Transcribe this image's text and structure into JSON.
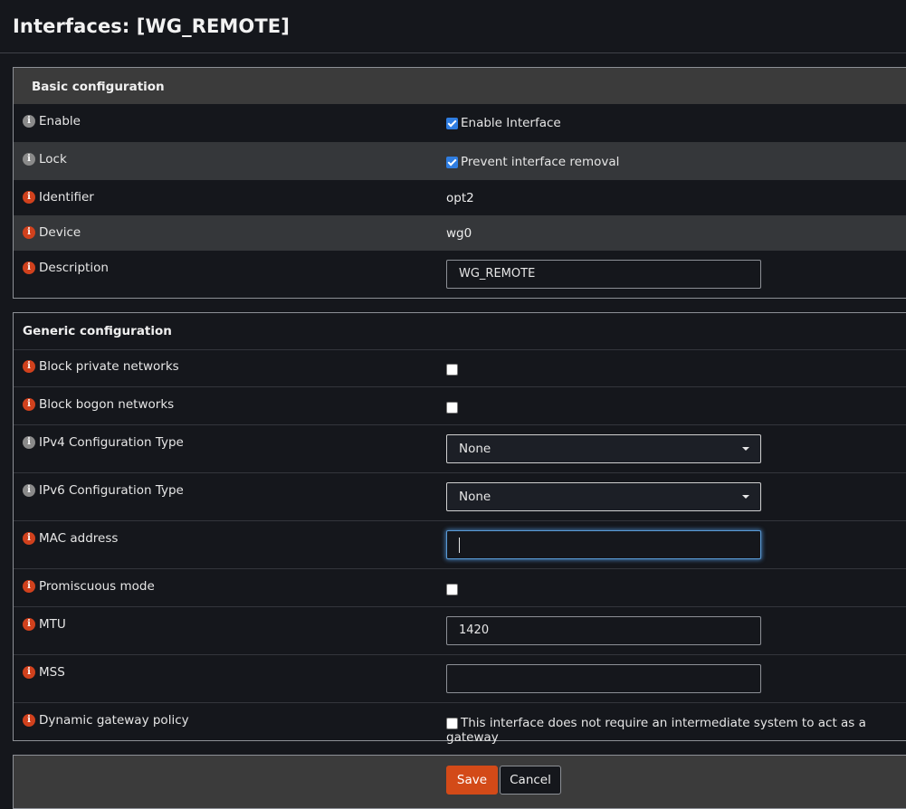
{
  "page": {
    "title": "Interfaces: [WG_REMOTE]"
  },
  "basic": {
    "header": "Basic configuration",
    "enable": {
      "label": "Enable",
      "checkbox_label": "Enable Interface",
      "checked": true
    },
    "lock": {
      "label": "Lock",
      "checkbox_label": "Prevent interface removal",
      "checked": true
    },
    "identifier": {
      "label": "Identifier",
      "value": "opt2"
    },
    "device": {
      "label": "Device",
      "value": "wg0"
    },
    "description": {
      "label": "Description",
      "value": "WG_REMOTE"
    }
  },
  "generic": {
    "header": "Generic configuration",
    "block_private": {
      "label": "Block private networks",
      "checked": false
    },
    "block_bogon": {
      "label": "Block bogon networks",
      "checked": false
    },
    "ipv4_type": {
      "label": "IPv4 Configuration Type",
      "selected": "None"
    },
    "ipv6_type": {
      "label": "IPv6 Configuration Type",
      "selected": "None"
    },
    "mac": {
      "label": "MAC address",
      "value": ""
    },
    "promiscuous": {
      "label": "Promiscuous mode",
      "checked": false
    },
    "mtu": {
      "label": "MTU",
      "value": "1420"
    },
    "mss": {
      "label": "MSS",
      "value": ""
    },
    "dynamic_gateway": {
      "label": "Dynamic gateway policy",
      "checkbox_label": "This interface does not require an intermediate system to act as a gateway",
      "checked": false
    }
  },
  "actions": {
    "save_label": "Save",
    "cancel_label": "Cancel"
  },
  "icons": {
    "info": "info-icon"
  },
  "colors": {
    "accent": "#d34a18",
    "info_orange": "#d0411d",
    "info_grey": "#8a8a8a",
    "checkbox_checked": "#2f7de1"
  }
}
